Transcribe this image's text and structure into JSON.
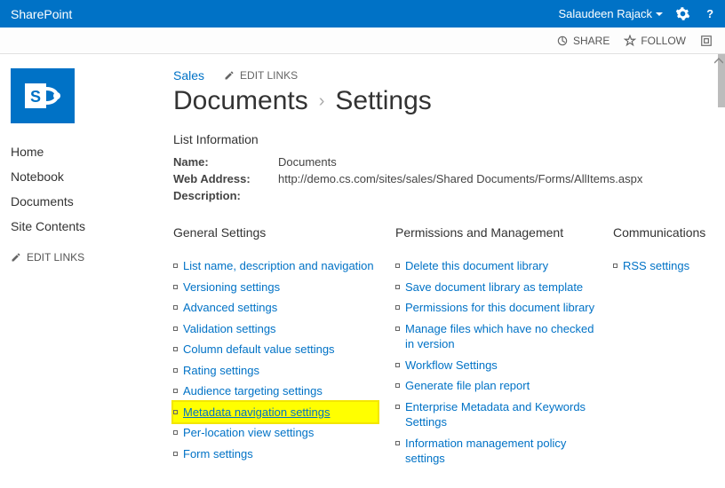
{
  "suite": {
    "product": "SharePoint",
    "user": "Salaudeen Rajack"
  },
  "ribbon": {
    "share": "SHARE",
    "follow": "FOLLOW"
  },
  "nav": {
    "items": [
      {
        "label": "Home"
      },
      {
        "label": "Notebook"
      },
      {
        "label": "Documents"
      },
      {
        "label": "Site Contents"
      }
    ],
    "edit_links": "EDIT LINKS"
  },
  "breadcrumb": {
    "site": "Sales",
    "edit_links": "EDIT LINKS"
  },
  "title": {
    "library": "Documents",
    "page": "Settings"
  },
  "list_info": {
    "heading": "List Information",
    "name_label": "Name:",
    "name_value": "Documents",
    "web_label": "Web Address:",
    "web_value": "http://demo.cs.com/sites/sales/Shared Documents/Forms/AllItems.aspx",
    "desc_label": "Description:",
    "desc_value": ""
  },
  "columns": {
    "general": {
      "heading": "General Settings",
      "items": [
        "List name, description and navigation",
        "Versioning settings",
        "Advanced settings",
        "Validation settings",
        "Column default value settings",
        "Rating settings",
        "Audience targeting settings",
        "Metadata navigation settings",
        "Per-location view settings",
        "Form settings"
      ],
      "highlight_index": 7
    },
    "permissions": {
      "heading": "Permissions and Management",
      "items": [
        "Delete this document library",
        "Save document library as template",
        "Permissions for this document library",
        "Manage files which have no checked in version",
        "Workflow Settings",
        "Generate file plan report",
        "Enterprise Metadata and Keywords Settings",
        "Information management policy settings"
      ]
    },
    "communications": {
      "heading": "Communications",
      "items": [
        "RSS settings"
      ]
    }
  }
}
